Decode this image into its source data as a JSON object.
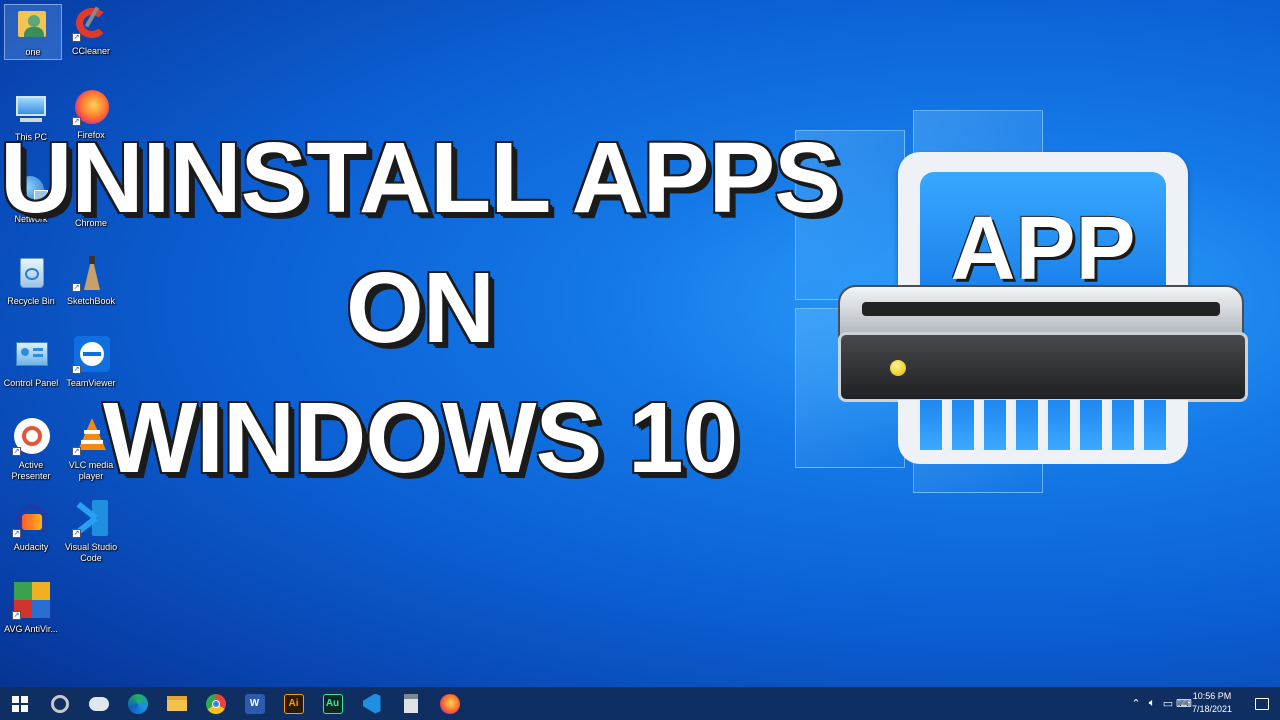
{
  "desktop_icons": [
    {
      "label": "one",
      "icon": "user-folder-icon"
    },
    {
      "label": "CCleaner",
      "icon": "ccleaner-icon"
    },
    {
      "label": "This PC",
      "icon": "computer-icon"
    },
    {
      "label": "Firefox",
      "icon": "firefox-icon"
    },
    {
      "label": "Network",
      "icon": "network-icon"
    },
    {
      "label": "Chrome",
      "icon": "chrome-icon"
    },
    {
      "label": "Recycle Bin",
      "icon": "recycle-bin-icon"
    },
    {
      "label": "SketchBook",
      "icon": "sketchbook-icon"
    },
    {
      "label": "Control Panel",
      "icon": "control-panel-icon"
    },
    {
      "label": "TeamViewer",
      "icon": "teamviewer-icon"
    },
    {
      "label": "Active Presenter",
      "icon": "activepresenter-icon"
    },
    {
      "label": "VLC media player",
      "icon": "vlc-icon"
    },
    {
      "label": "Audacity",
      "icon": "audacity-icon"
    },
    {
      "label": "Visual Studio Code",
      "icon": "vscode-icon"
    },
    {
      "label": "AVG AntiVir...",
      "icon": "avg-icon"
    }
  ],
  "title": {
    "line1": "UNINSTALL APPS",
    "line2": "ON",
    "line3": "WINDOWS 10"
  },
  "illustration": {
    "card_text": "APP",
    "icon": "app-shredder-icon"
  },
  "taskbar": {
    "apps": [
      {
        "icon": "start-windows-icon"
      },
      {
        "icon": "cortana-icon"
      },
      {
        "icon": "task-view-icon"
      },
      {
        "icon": "edge-icon"
      },
      {
        "icon": "file-explorer-icon"
      },
      {
        "icon": "chrome-icon"
      },
      {
        "icon": "word-icon",
        "text": "W"
      },
      {
        "icon": "illustrator-icon",
        "text": "Ai"
      },
      {
        "icon": "audition-icon",
        "text": "Au"
      },
      {
        "icon": "vscode-icon"
      },
      {
        "icon": "calculator-icon"
      },
      {
        "icon": "firefox-icon"
      }
    ],
    "tray_icons": [
      "chevron-up-icon",
      "volume-icon",
      "network-icon",
      "keyboard-icon"
    ],
    "time": "10:56 PM",
    "date": "7/18/2021"
  },
  "colors": {
    "desktop_accent": "#0b5fd3",
    "taskbar": "#0f2f62",
    "card_blue": "#1f86f0"
  }
}
